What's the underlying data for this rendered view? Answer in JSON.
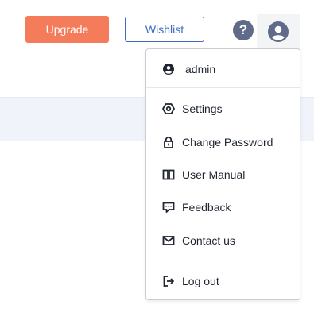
{
  "header": {
    "upgrade_label": "Upgrade",
    "wishlist_label": "Wishlist",
    "help_glyph": "?"
  },
  "menu": {
    "user": "admin",
    "items": [
      {
        "label": "Settings",
        "icon": "settings-icon"
      },
      {
        "label": "Change Password",
        "icon": "lock-icon"
      },
      {
        "label": "User Manual",
        "icon": "book-icon"
      },
      {
        "label": "Feedback",
        "icon": "feedback-icon"
      },
      {
        "label": "Contact us",
        "icon": "mail-icon"
      }
    ],
    "logout": "Log out"
  },
  "colors": {
    "upgrade": "#f47c5a",
    "wishlist": "#3d6cc1",
    "icon_gray": "#5f6b89",
    "band": "#f0f3fa"
  }
}
